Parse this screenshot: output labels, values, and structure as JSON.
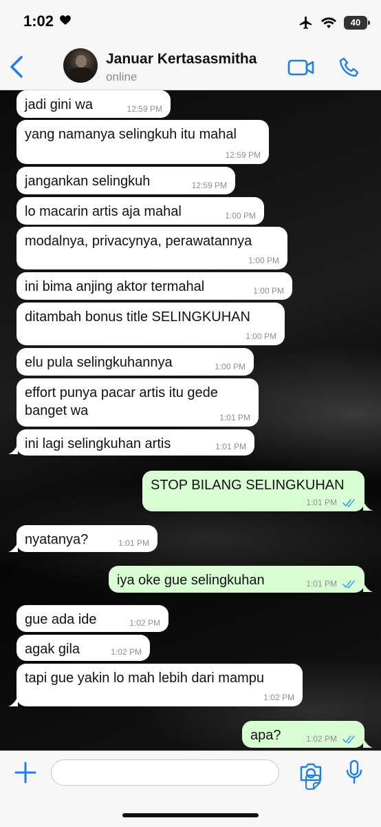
{
  "status_bar": {
    "time": "1:02",
    "battery": "40"
  },
  "header": {
    "contact_name": "Januar Kertasasmitha",
    "presence": "online"
  },
  "messages": [
    {
      "text": "jadi gini wa",
      "time": "12:59 PM"
    },
    {
      "text": "yang namanya selingkuh itu mahal",
      "time": "12:59 PM"
    },
    {
      "text": "jangankan selingkuh",
      "time": "12:59 PM"
    },
    {
      "text": "lo macarin artis aja mahal",
      "time": "1:00 PM"
    },
    {
      "text": "modalnya, privacynya, perawatannya",
      "time": "1:00 PM"
    },
    {
      "text": "ini bima anjing aktor termahal",
      "time": "1:00 PM"
    },
    {
      "text": "ditambah bonus title SELINGKUHAN",
      "time": "1:00 PM"
    },
    {
      "text": "elu pula selingkuhannya",
      "time": "1:00 PM"
    },
    {
      "text": "effort punya pacar artis itu gede\nbanget wa",
      "time": "1:01 PM"
    },
    {
      "text": "ini lagi selingkuhan artis",
      "time": "1:01 PM"
    },
    {
      "text": "STOP BILANG SELINGKUHAN",
      "time": "1:01 PM"
    },
    {
      "text": "nyatanya?",
      "time": "1:01 PM"
    },
    {
      "text": "iya oke gue selingkuhan",
      "time": "1:01 PM"
    },
    {
      "text": "gue ada ide",
      "time": "1:02 PM"
    },
    {
      "text": "agak gila",
      "time": "1:02 PM"
    },
    {
      "text": "tapi gue yakin lo mah lebih dari mampu",
      "time": "1:02 PM"
    },
    {
      "text": "apa?",
      "time": "1:02 PM"
    }
  ],
  "colors": {
    "accent": "#1a7ef2",
    "incoming": "#ffffff",
    "outgoing": "#d9fdd3",
    "read_ticks": "#34a8f0"
  }
}
